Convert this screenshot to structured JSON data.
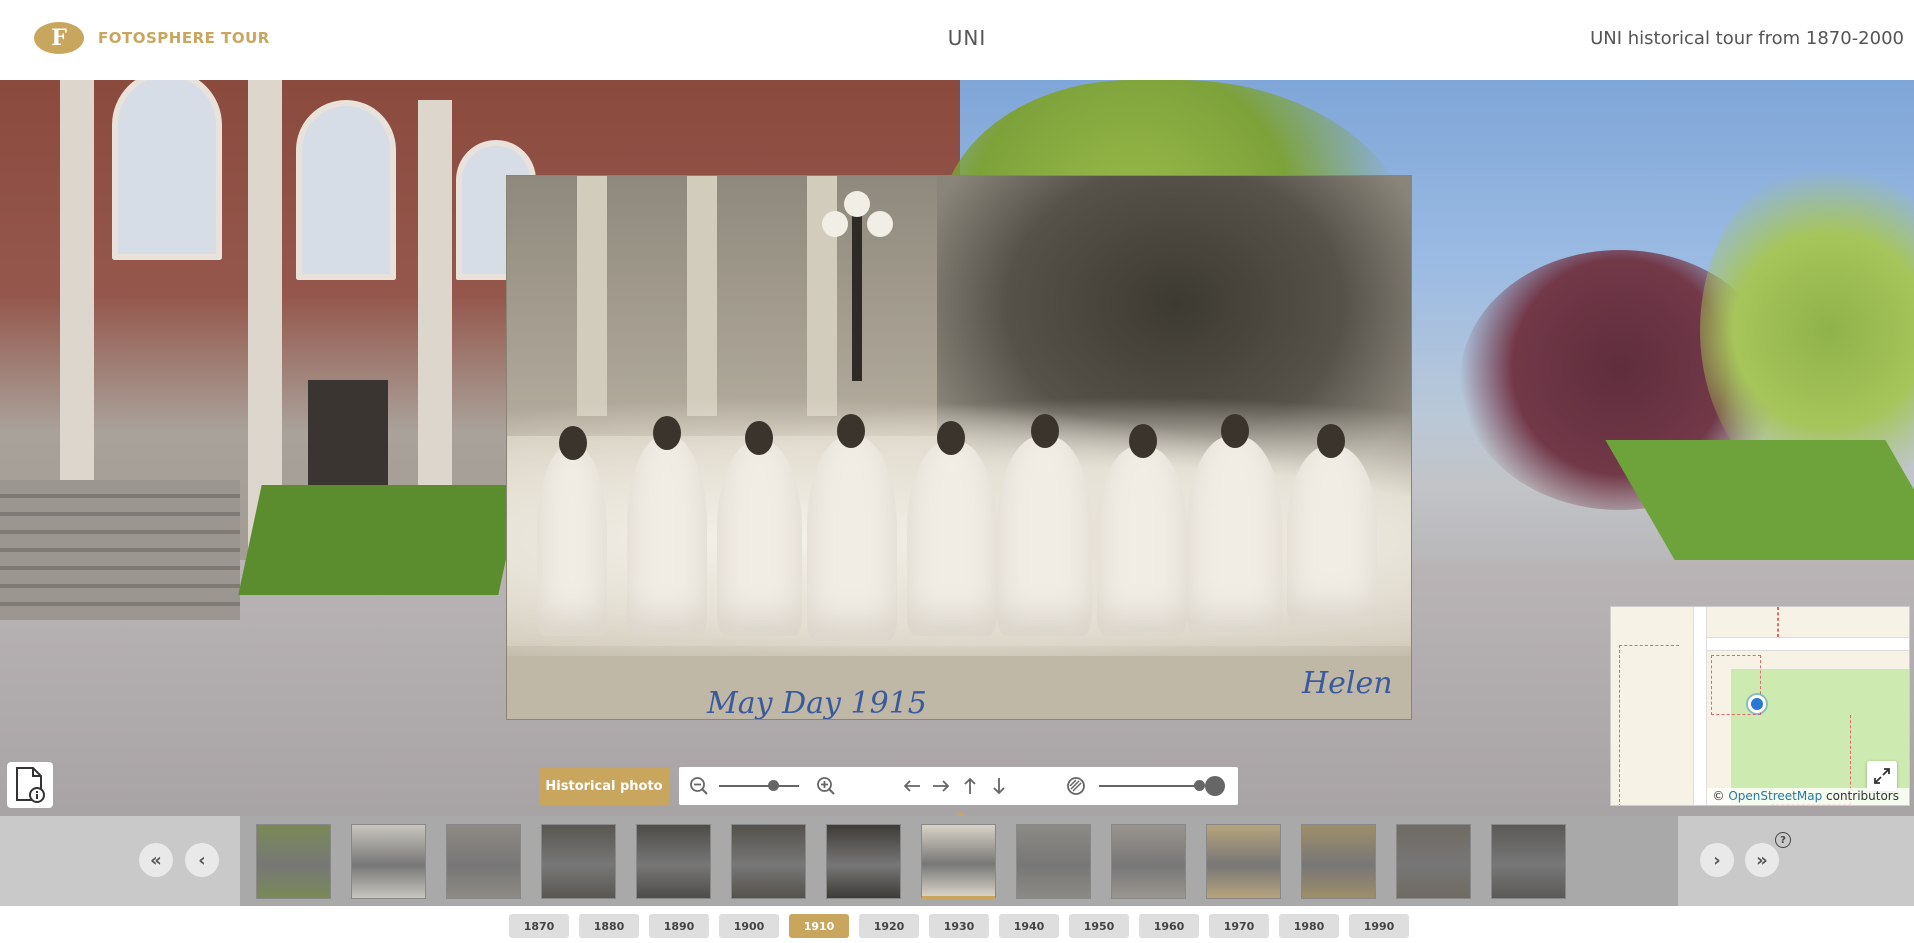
{
  "header": {
    "logo_letter": "F",
    "brand": "FOTOSPHERE TOUR",
    "title": "UNI",
    "subtitle": "UNI historical tour from 1870-2000"
  },
  "historical_photo": {
    "script_left": "May Day  1915",
    "script_right": "Helen"
  },
  "toolbar": {
    "label": "Historical photo",
    "zoom_level": 0.67,
    "opacity_level": 1.0
  },
  "minimap": {
    "attribution_prefix": "©",
    "attribution_link": "OpenStreetMap",
    "attribution_suffix": "contributors"
  },
  "timeline": {
    "thumbnails": [
      {
        "caption": "",
        "tone": "#7a8a55",
        "active": false
      },
      {
        "caption": "",
        "tone": "#c9c6bf",
        "active": false
      },
      {
        "caption": "",
        "tone": "#8e8a84",
        "active": false
      },
      {
        "caption": "",
        "tone": "#5a5752",
        "active": false
      },
      {
        "caption": "",
        "tone": "#4e4c48",
        "active": false
      },
      {
        "caption": "",
        "tone": "#55524d",
        "active": false
      },
      {
        "caption": "",
        "tone": "#3e3b37",
        "active": false
      },
      {
        "caption": "",
        "tone": "#d8d3c7",
        "active": true
      },
      {
        "caption": "",
        "tone": "#8c8a85",
        "active": false
      },
      {
        "caption": "",
        "tone": "#9a958f",
        "active": false
      },
      {
        "caption": "",
        "tone": "#b6a47c",
        "active": false
      },
      {
        "caption": "",
        "tone": "#9e8e6a",
        "active": false
      },
      {
        "caption": "",
        "tone": "#6f6a63",
        "active": false
      },
      {
        "caption": "",
        "tone": "#5b5a58",
        "active": false
      }
    ],
    "help": "?"
  },
  "decades": [
    "1870",
    "1880",
    "1890",
    "1900",
    "1910",
    "1920",
    "1930",
    "1940",
    "1950",
    "1960",
    "1970",
    "1980",
    "1990"
  ],
  "active_decade": "1910",
  "colors": {
    "accent": "#c8a65d"
  }
}
